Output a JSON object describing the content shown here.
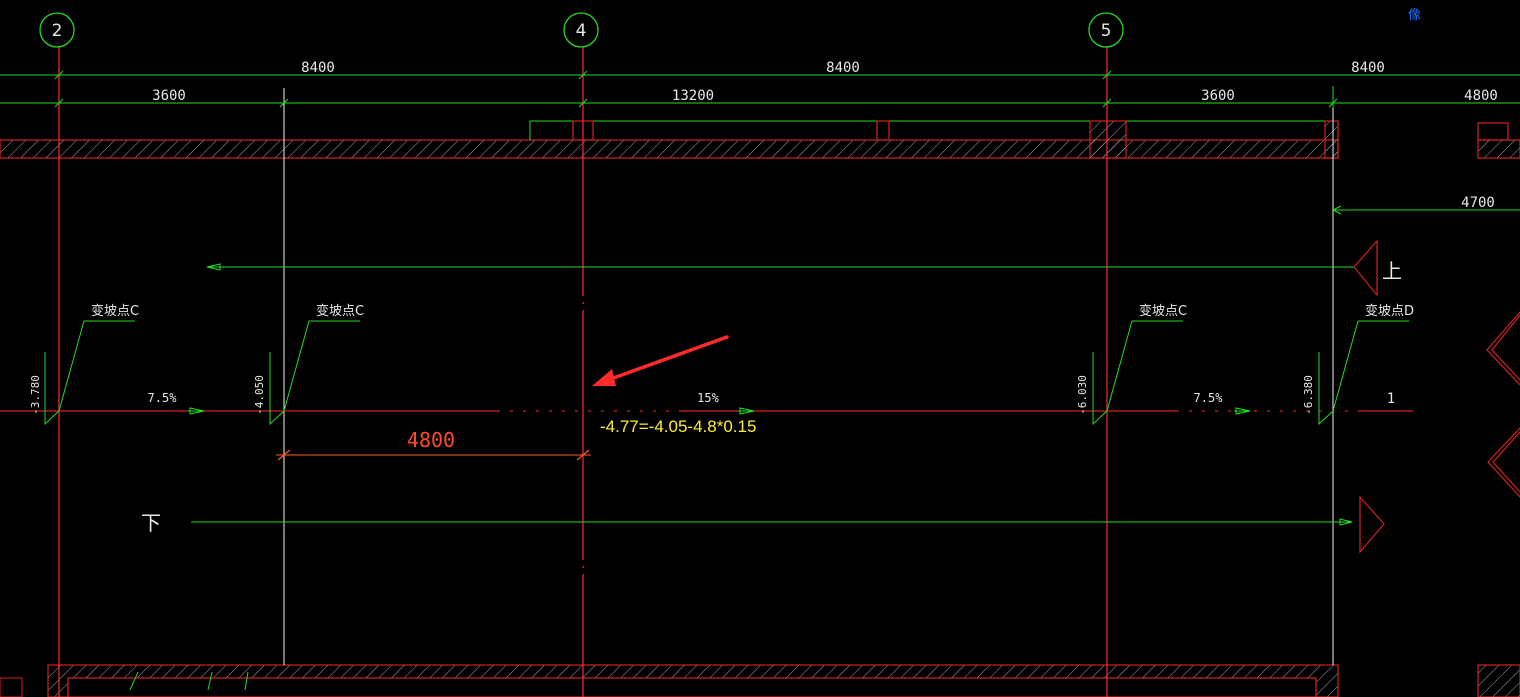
{
  "axes": [
    {
      "id": "axis-2",
      "label": "2"
    },
    {
      "id": "axis-4",
      "label": "4"
    },
    {
      "id": "axis-5",
      "label": "5"
    }
  ],
  "dimensions_row1": [
    "8400",
    "8400",
    "8400"
  ],
  "dimensions_row2": [
    "3600",
    "13200",
    "3600",
    "4800"
  ],
  "dimension_side": "4700",
  "change_points": [
    {
      "label": "变坡点C",
      "elevation": "-3.780"
    },
    {
      "label": "变坡点C",
      "elevation": "-4.050"
    },
    {
      "label": "变坡点C",
      "elevation": "-6.030"
    },
    {
      "label": "变坡点D",
      "elevation": "-6.380"
    }
  ],
  "slopes": [
    "7.5%",
    "15%",
    "7.5%"
  ],
  "slope_end_label": "1",
  "measure_4800": "4800",
  "formula": "-4.77=-4.05-4.8*0.15",
  "dir_up": "上",
  "dir_down": "下",
  "corner_text": "像",
  "colors": {
    "background": "#000000",
    "axis_line": "#ff2a2a",
    "dimension_line": "#22dd22",
    "wall": "#d42020",
    "hatch": "#b8b8b8",
    "annotation_arrow": "#ff2a2a",
    "formula": "#ffee33"
  }
}
